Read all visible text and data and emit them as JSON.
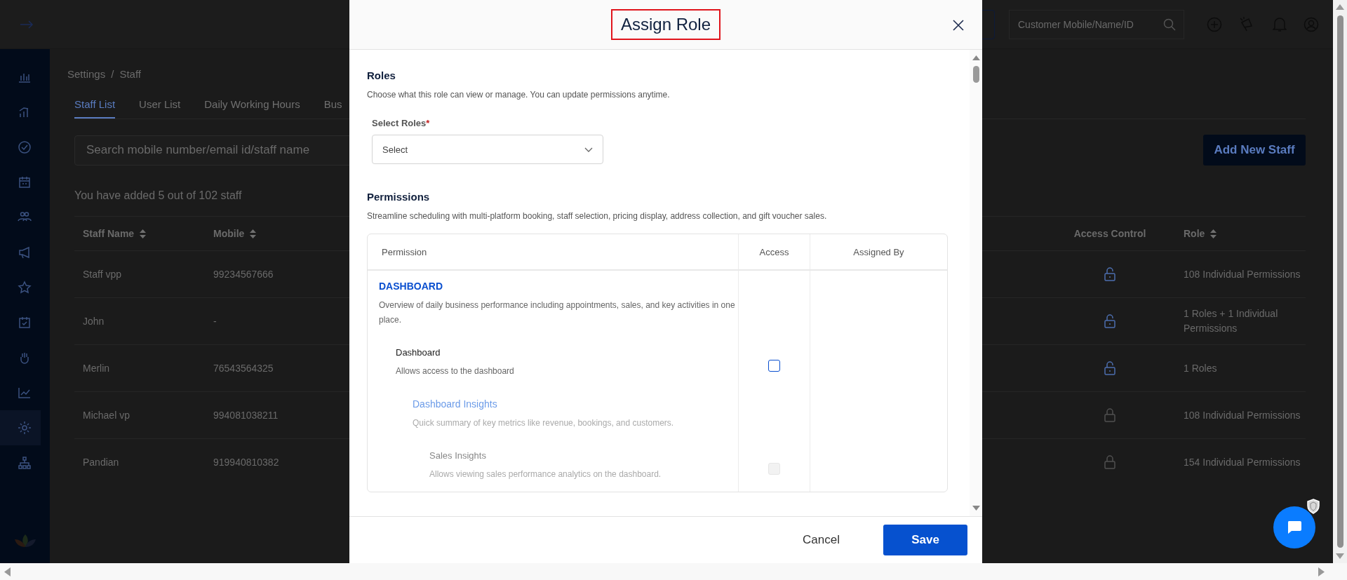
{
  "app_header": {
    "search": {
      "placeholder": "Customer Mobile/Name/ID"
    }
  },
  "sidebar": {
    "items": [
      {
        "selected": false
      },
      {
        "selected": false
      },
      {
        "selected": false
      },
      {
        "selected": false
      },
      {
        "selected": false
      },
      {
        "selected": false
      },
      {
        "selected": false
      },
      {
        "selected": false
      },
      {
        "selected": false
      },
      {
        "selected": false
      },
      {
        "selected": true
      },
      {
        "selected": false
      }
    ]
  },
  "breadcrumb": {
    "items": [
      "Settings",
      "Staff"
    ],
    "separator": "/"
  },
  "tabs": [
    {
      "label": "Staff List",
      "selected": true
    },
    {
      "label": "User List",
      "selected": false
    },
    {
      "label": "Daily Working Hours",
      "selected": false
    },
    {
      "label": "Bus",
      "selected": false
    }
  ],
  "staff_search": {
    "placeholder": "Search mobile number/email id/staff name"
  },
  "add_button": "Add New Staff",
  "staff_count": "You have added 5 out of 102 staff",
  "staff_table": {
    "columns": [
      {
        "label": "Staff Name",
        "sortable": true
      },
      {
        "label": "Mobile",
        "sortable": true
      },
      {
        "label": "Access Control",
        "sortable": false
      },
      {
        "label": "Role",
        "sortable": true
      }
    ],
    "rows": [
      {
        "name": "Staff vpp",
        "mobile": "99234567666",
        "unlocked": true,
        "role": "108 Individual Permissions"
      },
      {
        "name": "John",
        "mobile": "-",
        "unlocked": true,
        "role": "1 Roles + 1 Individual Permissions"
      },
      {
        "name": "Merlin",
        "mobile": "76543564325",
        "unlocked": true,
        "role": "1 Roles"
      },
      {
        "name": "Michael vp",
        "mobile": "994081038211",
        "unlocked": false,
        "role": "108 Individual Permissions"
      },
      {
        "name": "Pandian",
        "mobile": "919940810382",
        "unlocked": false,
        "role": "154 Individual Permissions"
      }
    ]
  },
  "modal": {
    "title": "Assign Role",
    "roles": {
      "heading": "Roles",
      "description": "Choose what this role can view or manage. You can update permissions anytime.",
      "select_label": "Select Roles",
      "required_mark": "*",
      "select_value": "Select"
    },
    "permissions": {
      "heading": "Permissions",
      "description": "Streamline scheduling with multi-platform booking, staff selection, pricing display, address collection, and gift voucher sales.",
      "columns": [
        "Permission",
        "Access",
        "Assigned By"
      ],
      "rows": [
        {
          "kind": "group",
          "title": "DASHBOARD",
          "description": "Overview of daily business performance including appointments, sales, and key activities in one place.",
          "disabled": false,
          "children": [
            {
              "kind": "permission",
              "title": "Dashboard",
              "description": "Allows access to the dashboard",
              "checked": false,
              "disabled": false,
              "children": [
                {
                  "kind": "group",
                  "title": "Dashboard Insights",
                  "description": "Quick summary of key metrics like revenue, bookings, and customers.",
                  "disabled": true,
                  "children": [
                    {
                      "kind": "permission",
                      "title": "Sales Insights",
                      "description": "Allows viewing sales performance analytics on the dashboard.",
                      "checked": false,
                      "disabled": true
                    }
                  ]
                }
              ]
            }
          ]
        }
      ]
    },
    "buttons": {
      "cancel": "Cancel",
      "save": "Save"
    }
  }
}
